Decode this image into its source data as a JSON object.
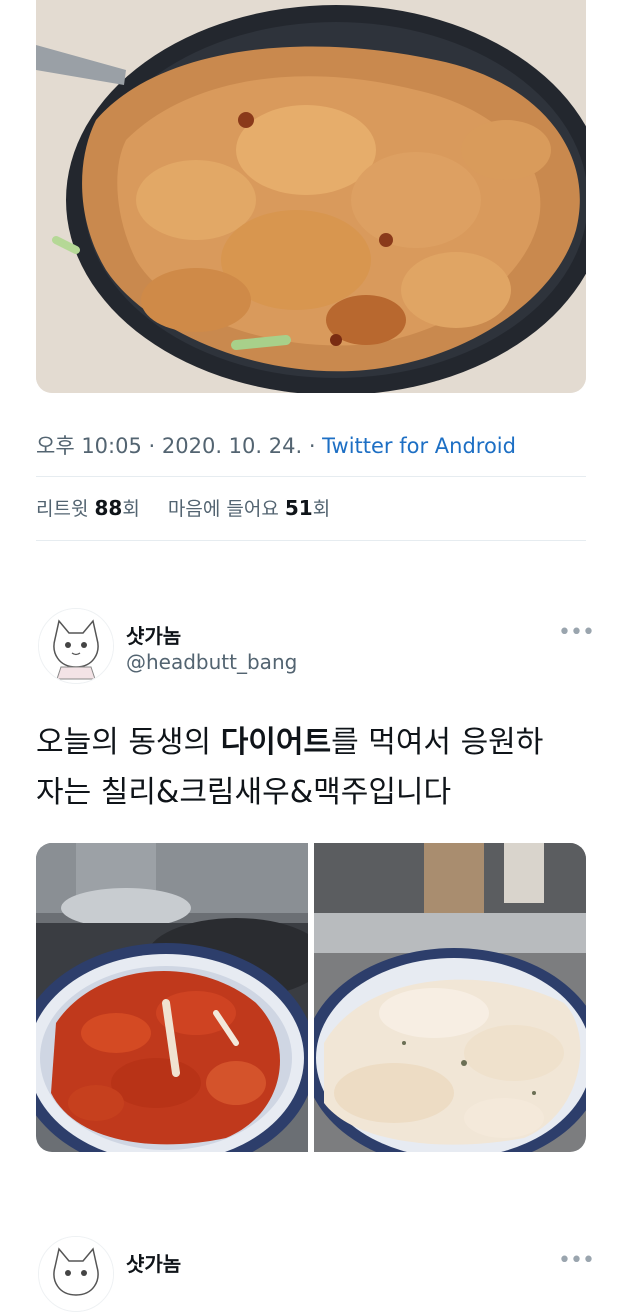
{
  "tweet_top": {
    "meta": {
      "time": "오후 10:05",
      "separator": " · ",
      "date": "2020. 10. 24.",
      "source": "Twitter for Android"
    },
    "stats": {
      "retweet_label": "리트윗",
      "retweet_count": "88",
      "retweet_unit": "회",
      "likes_label": "마음에 들어요",
      "likes_count": "51",
      "likes_unit": "회"
    },
    "photo_icon": "fried-chicken-pan-photo"
  },
  "tweet_main": {
    "display_name": "샷가놈",
    "handle": "@headbutt_bang",
    "more_icon": "•••",
    "text": {
      "line1_a": "오늘의 동생의 ",
      "line1_b": "다이어트",
      "line1_c": "를 먹여서 응원하",
      "line2": "자는 칠리&크림새우&맥주입니다"
    },
    "photos": [
      "chili-shrimp-photo",
      "cream-shrimp-photo"
    ]
  },
  "tweet_next": {
    "display_name": "샷가놈",
    "more_icon": "•••"
  },
  "colors": {
    "text": "#0f1419",
    "secondary": "#536471",
    "link": "#1d6fc4",
    "divider": "#e6ecf0"
  }
}
